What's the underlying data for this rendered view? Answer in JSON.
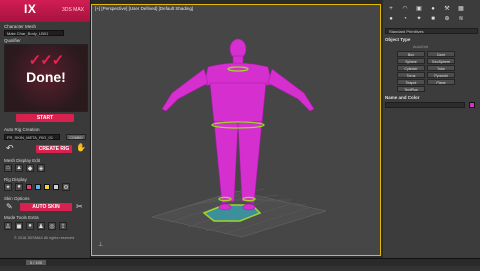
{
  "left_panel": {
    "logo_text": "IX",
    "logo_sub": "3DS MAX",
    "character_mesh_label": "Character Mesh",
    "character_mesh_value": "Male Char_Body_LB01",
    "qualifier_label": "Qualifier",
    "checks": "✓✓✓",
    "done_text": "Done!",
    "start_label": "START",
    "auto_rig_creation_label": "Auto Rig Creation",
    "rig_field_value": "FR_SKIN_META_RIG_01",
    "combo_label": "COMBO",
    "create_rig_label": "CREATE RIG",
    "mesh_display_label": "Mesh Display Edit",
    "rig_display_label": "Rig Display",
    "skin_options_label": "Skin Options",
    "auto_skin_label": "AUTO SKIN",
    "mode_tools_label": "Mode Tools Extra",
    "copyright": "© 2018 3DSMAX All rights reserved",
    "swatch_colors": [
      "#e23a7a",
      "#5ab4e8",
      "#f0d23a",
      "#cfcfcf"
    ]
  },
  "viewport": {
    "title": "[+] [Perspective] [User Defined] [Default Shading]",
    "body_color": "#d52fd0",
    "belt_color": "#9ed62a"
  },
  "right_panel": {
    "toolbar_icons": [
      "plus-icon",
      "arc-icon",
      "box-icon",
      "circle-icon",
      "wrench-icon",
      "grid-icon"
    ],
    "category_value": "Standard Primitives",
    "object_type_label": "Object Type",
    "autogrid_label": "AutoGrid",
    "object_buttons": [
      "Box",
      "Cone",
      "Sphere",
      "GeoSphere",
      "Cylinder",
      "Tube",
      "Torus",
      "Pyramid",
      "Teapot",
      "Plane",
      "TextPlus"
    ],
    "name_color_label": "Name and Color",
    "name_value": "",
    "name_color": "#d52fd0"
  },
  "timeline": {
    "frame_label": "0 / 100"
  }
}
